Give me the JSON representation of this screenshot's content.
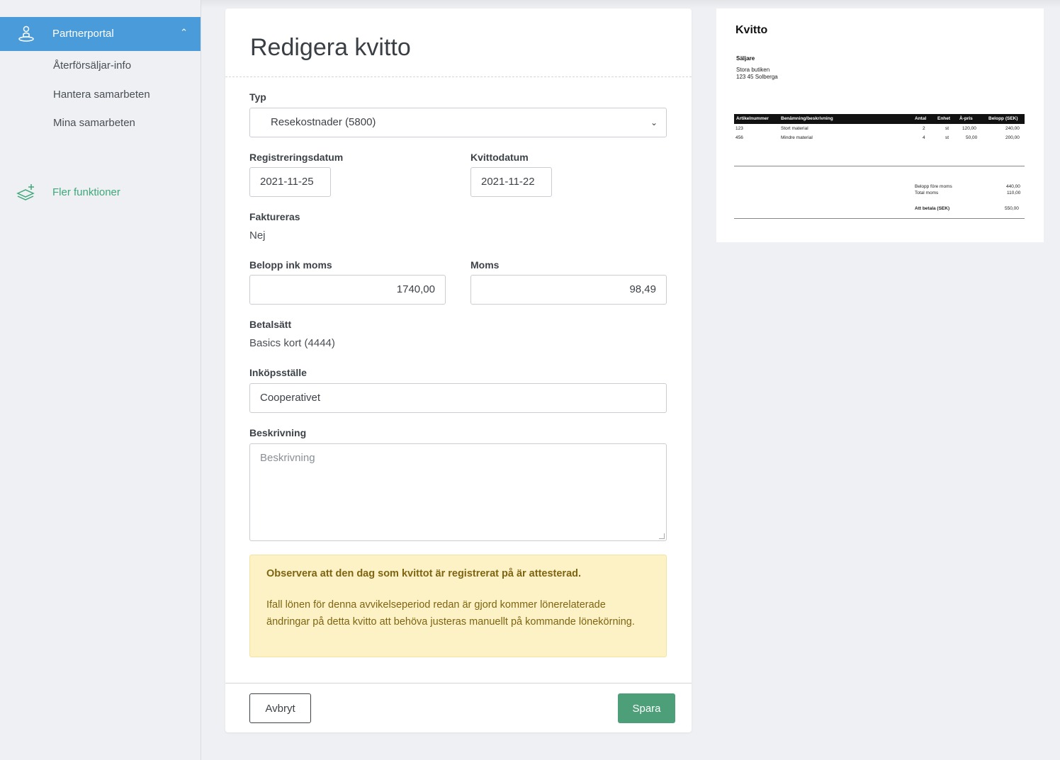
{
  "sidebar": {
    "active": {
      "label": "Partnerportal",
      "icon": "partner-icon"
    },
    "subitems": [
      "Återförsäljar-info",
      "Hantera samarbeten",
      "Mina samarbeten"
    ],
    "more": {
      "label": "Fler funktioner",
      "icon": "layers-plus-icon"
    }
  },
  "form": {
    "title": "Redigera kvitto",
    "typ": {
      "label": "Typ",
      "value": "Resekostnader (5800)"
    },
    "reg_date": {
      "label": "Registreringsdatum",
      "value": "2021-11-25"
    },
    "receipt_date": {
      "label": "Kvittodatum",
      "value": "2021-11-22"
    },
    "invoiced": {
      "label": "Faktureras",
      "value": "Nej"
    },
    "amount": {
      "label": "Belopp ink moms",
      "value": "1740,00"
    },
    "vat": {
      "label": "Moms",
      "value": "98,49"
    },
    "payment": {
      "label": "Betalsätt",
      "value": "Basics kort (4444)"
    },
    "store": {
      "label": "Inköpsställe",
      "value": "Cooperativet"
    },
    "description": {
      "label": "Beskrivning",
      "placeholder": "Beskrivning"
    },
    "alert": {
      "title": "Observera att den dag som kvittot är registrerat på är attesterad.",
      "body": "Ifall lönen för denna avvikelseperiod redan är gjord kommer lönerelaterade ändringar på detta kvitto att behöva justeras manuellt på kommande lönekörning."
    },
    "cancel_label": "Avbryt",
    "save_label": "Spara"
  },
  "receipt": {
    "title": "Kvitto",
    "seller_label": "Säljare",
    "seller_name": "Stora butiken",
    "seller_address": "123 45 Solberga",
    "columns": [
      "Artikelnummer",
      "Benämning/beskrivning",
      "Antal",
      "Enhet",
      "À-pris",
      "Belopp (SEK)"
    ],
    "rows": [
      [
        "123",
        "Stort material",
        "2",
        "st",
        "120,00",
        "240,00"
      ],
      [
        "456",
        "Mindre material",
        "4",
        "st",
        "50,00",
        "200,00"
      ]
    ],
    "totals": {
      "before_vat_label": "Belopp före moms",
      "before_vat": "440,00",
      "vat_label": "Total moms",
      "vat": "110,00",
      "pay_label": "Att betala (SEK)",
      "pay": "550,00"
    }
  }
}
